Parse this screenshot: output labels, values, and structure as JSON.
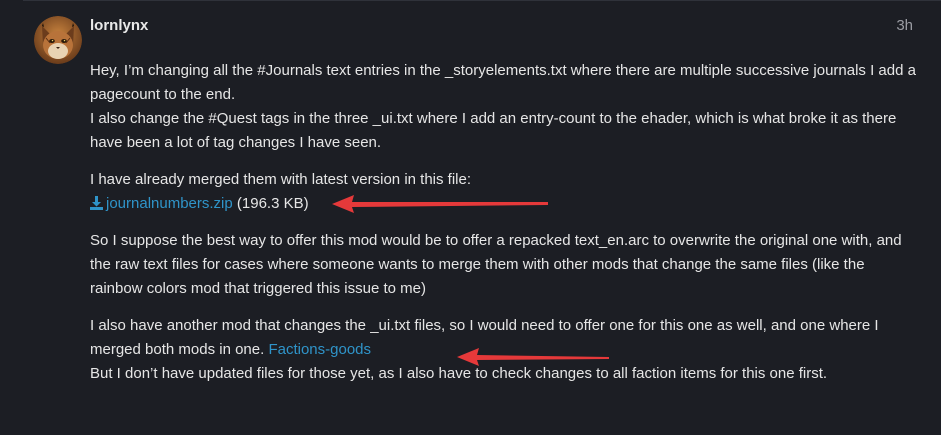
{
  "post": {
    "username": "lornlynx",
    "timestamp": "3h",
    "paragraph1": {
      "line1": "Hey, I’m changing all the #Journals text entries in the _storyelements.txt where there are multiple successive journals I add a pagecount to the end.",
      "line2": "I also change the #Quest tags in the three _ui.txt where I add an entry-count to the ehader, which is what broke it as there have been a lot of tag changes I have seen."
    },
    "paragraph2": {
      "intro": "I have already merged them with latest version in this file:",
      "attachment_name": "journalnumbers.zip",
      "attachment_size": "(196.3 KB)"
    },
    "paragraph3": "So I suppose the best way to offer this mod would be to offer a repacked text_en.arc to overwrite the original one with, and the raw text files for cases where someone wants to merge them with other mods that change the same files (like the rainbow colors mod that triggered this issue to me)",
    "paragraph4": {
      "text_before_link": "I also have another mod that changes the _ui.txt files, so I would need to offer one for this one as well, and one where I merged both mods in one.",
      "link_text": "Factions-goods",
      "text_after_link": "But I don’t have updated files for those yet, as I also have to check changes to all faction items for this one first."
    }
  },
  "icons": {
    "avatar": "lynx-avatar",
    "download": "download-icon"
  },
  "colors": {
    "background": "#1c1e24",
    "text": "#e6e6e6",
    "link": "#2f94c9",
    "muted": "#9a9ca3",
    "annotation_arrow": "#e5393a"
  }
}
